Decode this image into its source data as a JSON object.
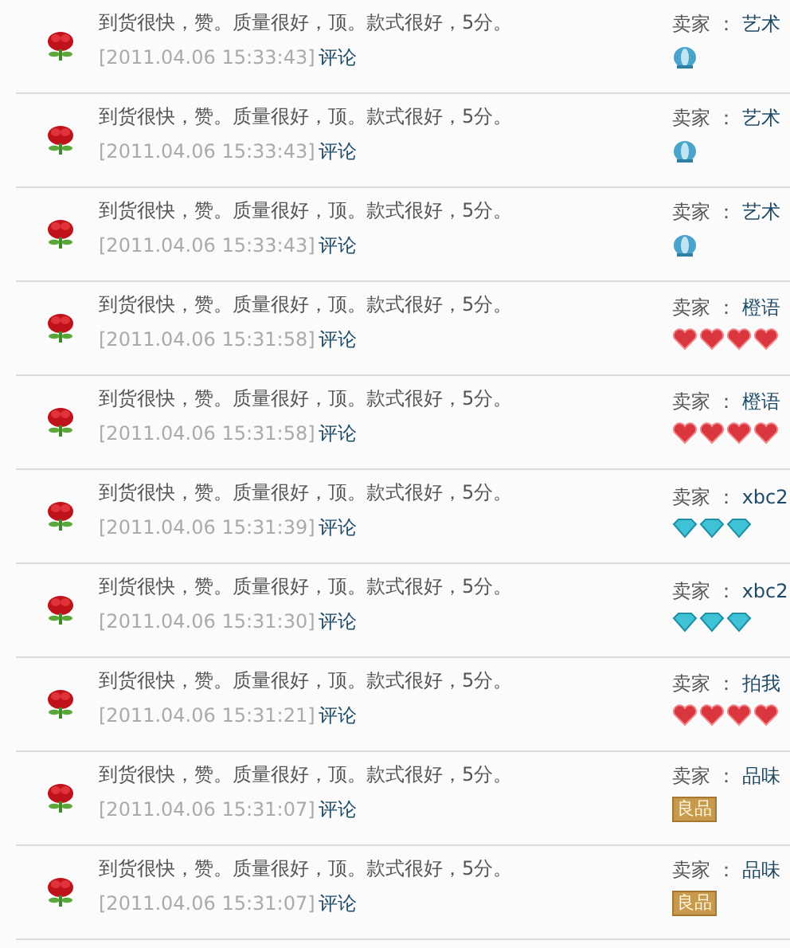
{
  "reviews": [
    {
      "text": "到货很快，赞。质量很好，顶。款式很好，5分。",
      "time": "[2011.04.06 15:33:43]",
      "link": "评论",
      "seller_label": "卖家 ：",
      "seller": "艺术",
      "rank": {
        "kind": "crown"
      }
    },
    {
      "text": "到货很快，赞。质量很好，顶。款式很好，5分。",
      "time": "[2011.04.06 15:33:43]",
      "link": "评论",
      "seller_label": "卖家 ：",
      "seller": "艺术",
      "rank": {
        "kind": "crown"
      }
    },
    {
      "text": "到货很快，赞。质量很好，顶。款式很好，5分。",
      "time": "[2011.04.06 15:33:43]",
      "link": "评论",
      "seller_label": "卖家 ：",
      "seller": "艺术",
      "rank": {
        "kind": "crown"
      }
    },
    {
      "text": "到货很快，赞。质量很好，顶。款式很好，5分。",
      "time": "[2011.04.06 15:31:58]",
      "link": "评论",
      "seller_label": "卖家 ：",
      "seller": "橙语",
      "rank": {
        "kind": "heart",
        "stars": 4
      }
    },
    {
      "text": "到货很快，赞。质量很好，顶。款式很好，5分。",
      "time": "[2011.04.06 15:31:58]",
      "link": "评论",
      "seller_label": "卖家 ：",
      "seller": "橙语",
      "rank": {
        "kind": "heart",
        "stars": 4
      }
    },
    {
      "text": "到货很快，赞。质量很好，顶。款式很好，5分。",
      "time": "[2011.04.06 15:31:39]",
      "link": "评论",
      "seller_label": "卖家 ：",
      "seller": "xbc2",
      "rank": {
        "kind": "diamond",
        "stars": 3
      }
    },
    {
      "text": "到货很快，赞。质量很好，顶。款式很好，5分。",
      "time": "[2011.04.06 15:31:30]",
      "link": "评论",
      "seller_label": "卖家 ：",
      "seller": "xbc2",
      "rank": {
        "kind": "diamond",
        "stars": 3
      }
    },
    {
      "text": "到货很快，赞。质量很好，顶。款式很好，5分。",
      "time": "[2011.04.06 15:31:21]",
      "link": "评论",
      "seller_label": "卖家 ：",
      "seller": "拍我",
      "rank": {
        "kind": "heart",
        "stars": 4
      }
    },
    {
      "text": "到货很快，赞。质量很好，顶。款式很好，5分。",
      "time": "[2011.04.06 15:31:07]",
      "link": "评论",
      "seller_label": "卖家 ：",
      "seller": "品味",
      "rank": {
        "kind": "label",
        "text": "良品"
      }
    },
    {
      "text": "到货很快，赞。质量很好，顶。款式很好，5分。",
      "time": "[2011.04.06 15:31:07]",
      "link": "评论",
      "seller_label": "卖家 ：",
      "seller": "品味",
      "rank": {
        "kind": "label",
        "text": "良品"
      }
    }
  ]
}
